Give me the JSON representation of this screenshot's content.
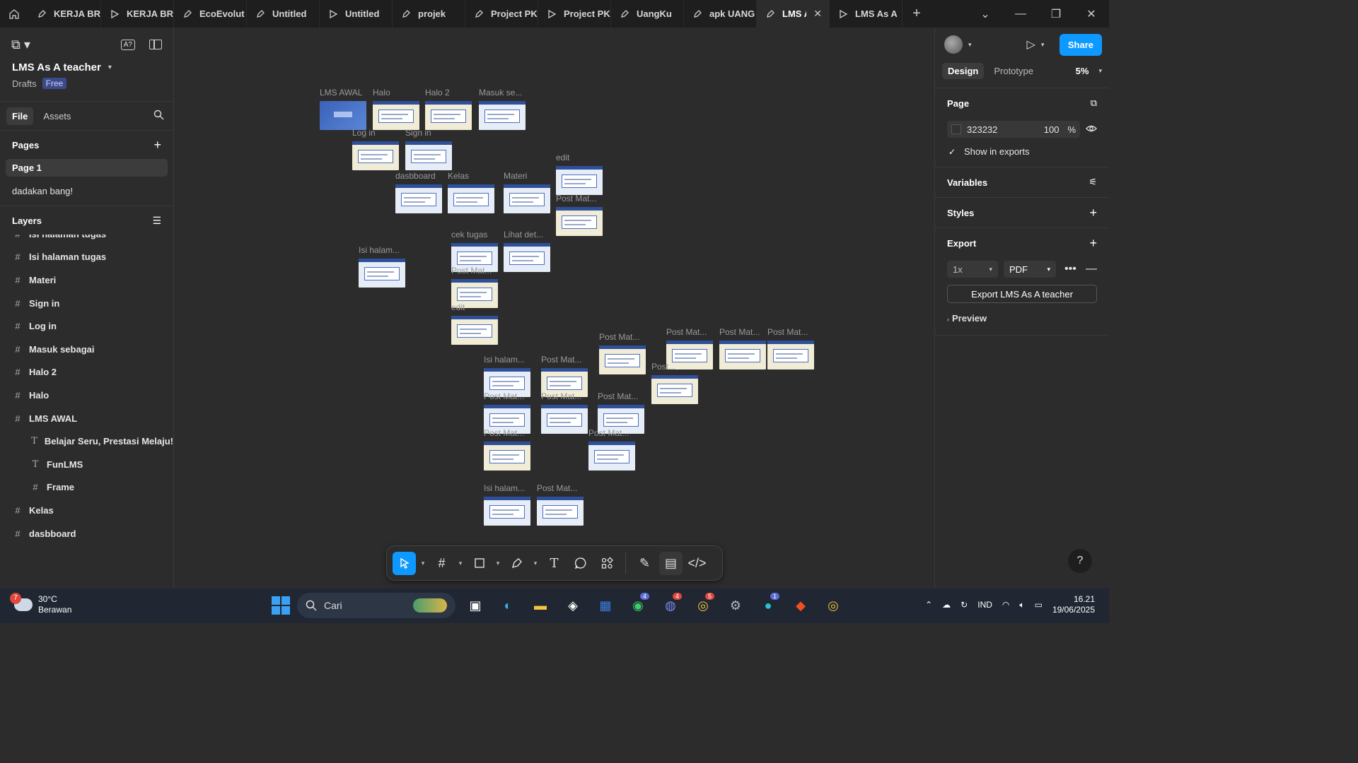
{
  "tabs": [
    {
      "label": "KERJA BR",
      "kind": "design"
    },
    {
      "label": "KERJA BR",
      "kind": "proto"
    },
    {
      "label": "EcoEvolut",
      "kind": "design"
    },
    {
      "label": "Untitled",
      "kind": "design"
    },
    {
      "label": "Untitled",
      "kind": "proto"
    },
    {
      "label": "projek",
      "kind": "design"
    },
    {
      "label": "Project PK",
      "kind": "design"
    },
    {
      "label": "Project PK",
      "kind": "proto"
    },
    {
      "label": "UangKu",
      "kind": "design"
    },
    {
      "label": "apk UANG",
      "kind": "design"
    },
    {
      "label": "LMS A",
      "kind": "design",
      "active": true
    },
    {
      "label": "LMS As A",
      "kind": "proto"
    }
  ],
  "project": {
    "title": "LMS As A teacher",
    "location": "Drafts",
    "plan": "Free"
  },
  "file_tabs": {
    "file": "File",
    "assets": "Assets"
  },
  "pages": {
    "heading": "Pages",
    "items": [
      "Page 1",
      "dadakan bang!"
    ]
  },
  "layers": {
    "heading": "Layers",
    "items": [
      {
        "name": "Isi halaman tugas",
        "type": "frame",
        "child": false
      },
      {
        "name": "Isi halaman tugas",
        "type": "frame",
        "child": false
      },
      {
        "name": "Materi",
        "type": "frame",
        "child": false
      },
      {
        "name": "Sign in",
        "type": "frame",
        "child": false
      },
      {
        "name": "Log in",
        "type": "frame",
        "child": false
      },
      {
        "name": "Masuk sebagai",
        "type": "frame",
        "child": false
      },
      {
        "name": "Halo 2",
        "type": "frame",
        "child": false
      },
      {
        "name": "Halo",
        "type": "frame",
        "child": false
      },
      {
        "name": "LMS AWAL",
        "type": "frame",
        "child": false
      },
      {
        "name": "Belajar Seru, Prestasi Melaju!",
        "type": "text",
        "child": true
      },
      {
        "name": "FunLMS",
        "type": "text",
        "child": true
      },
      {
        "name": "Frame",
        "type": "frame",
        "child": true
      },
      {
        "name": "Kelas",
        "type": "frame",
        "child": false
      },
      {
        "name": "dasbboard",
        "type": "frame",
        "child": false
      }
    ]
  },
  "canvas_labels": [
    "LMS AWAL",
    "Halo",
    "Halo 2",
    "Masuk se...",
    "Log in",
    "Sign in",
    "dasbboard",
    "Kelas",
    "Materi",
    "edit",
    "Post Mat...",
    "cek tugas",
    "Lihat det...",
    "Isi halam...",
    "Post Mat...",
    "edit",
    "Post Mat...",
    "Post Mat...",
    "Post Mat...",
    "Post Mat...",
    "Isi halam...",
    "Post Mat...",
    "Post...",
    "Post Mat...",
    "Post Mat...",
    "Post Mat...",
    "Post Mat...",
    "Post Mat...",
    "Isi halam...",
    "Post Mat..."
  ],
  "right": {
    "share": "Share",
    "design_tab": "Design",
    "prototype_tab": "Prototype",
    "zoom": "5%",
    "page_heading": "Page",
    "page_color": "323232",
    "page_opacity": "100",
    "opacity_unit": "%",
    "show_in_exports": "Show in exports",
    "variables": "Variables",
    "styles": "Styles",
    "export_heading": "Export",
    "export_scale": "1x",
    "export_format": "PDF",
    "export_button": "Export LMS As A teacher",
    "preview": "Preview"
  },
  "taskbar": {
    "weather_badge": "7",
    "temperature": "30°C",
    "weather": "Berawan",
    "search_placeholder": "Cari",
    "whatsapp_count": "4",
    "discord_count": "4",
    "chrome_count": "5",
    "canva_count": "1",
    "language": "IND",
    "time": "16.21",
    "date": "19/06/2025"
  }
}
